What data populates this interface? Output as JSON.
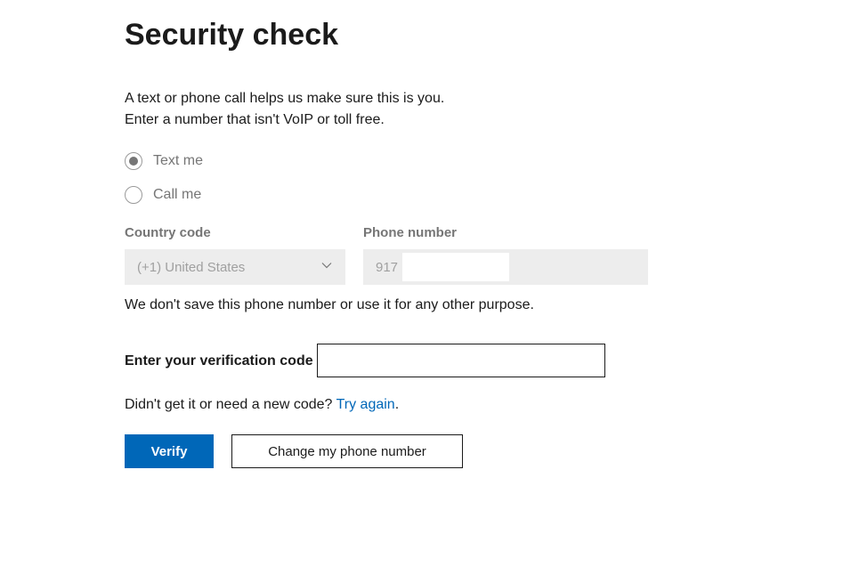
{
  "title": "Security check",
  "intro_line1": "A text or phone call helps us make sure this is you.",
  "intro_line2": "Enter a number that isn't VoIP or toll free.",
  "contact_method": {
    "options": [
      {
        "label": "Text me",
        "selected": true
      },
      {
        "label": "Call me",
        "selected": false
      }
    ]
  },
  "country": {
    "label": "Country code",
    "value": "(+1) United States"
  },
  "phone": {
    "label": "Phone number",
    "value": "917"
  },
  "disclaimer": "We don't save this phone number or use it for any other purpose.",
  "verification": {
    "label": "Enter your verification code",
    "value": ""
  },
  "retry": {
    "prefix": "Didn't get it or need a new code? ",
    "link": "Try again",
    "suffix": "."
  },
  "buttons": {
    "verify": "Verify",
    "change": "Change my phone number"
  }
}
